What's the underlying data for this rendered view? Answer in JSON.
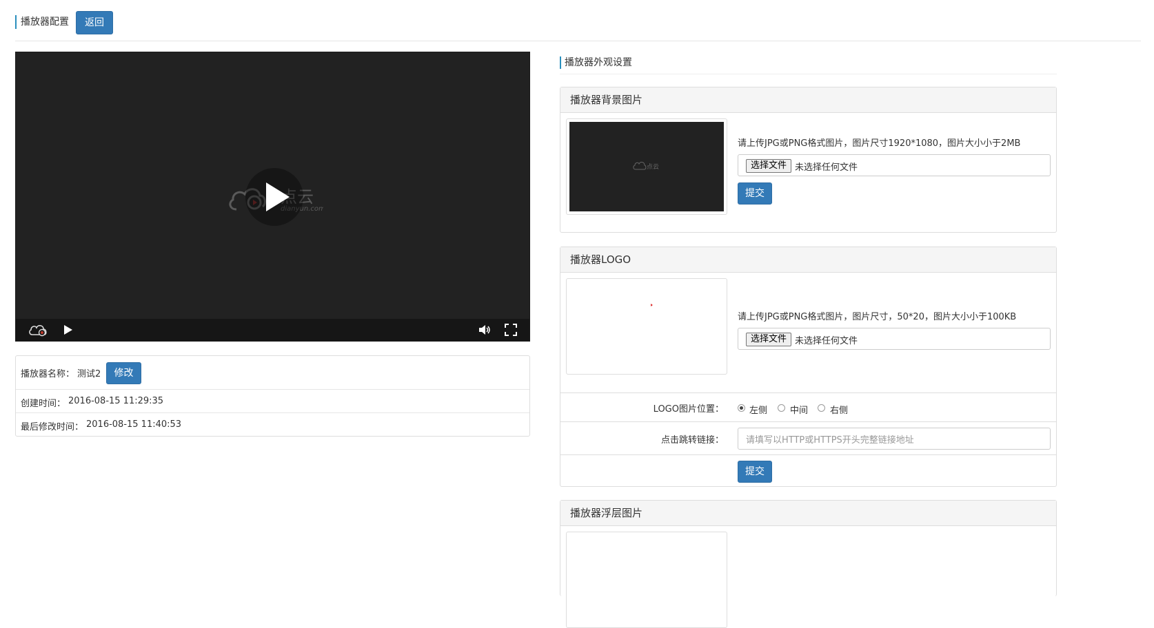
{
  "header": {
    "title": "播放器配置",
    "back_label": "返回"
  },
  "player": {
    "logo_text": "点云",
    "logo_domain": "dianyun.com",
    "controls": [
      "cloud-logo-icon",
      "play-icon",
      "volume-icon",
      "fullscreen-icon"
    ]
  },
  "info": {
    "name_label": "播放器名称：",
    "name_value": "测试2",
    "modify_label": "修改",
    "created_label": "创建时间：",
    "created_value": "2016-08-15 11:29:35",
    "modified_label": "最后修改时间：",
    "modified_value": "2016-08-15 11:40:53"
  },
  "appearance": {
    "section_title": "播放器外观设置",
    "background": {
      "heading": "播放器背景图片",
      "thumb_text": "点云",
      "hint": "请上传JPG或PNG格式图片，图片尺寸1920*1080，图片大小小于2MB",
      "file_button": "选择文件",
      "file_status": "未选择任何文件",
      "submit_label": "提交"
    },
    "logo": {
      "heading": "播放器LOGO",
      "hint": "请上传JPG或PNG格式图片，图片尺寸，50*20，图片大小小于100KB",
      "file_button": "选择文件",
      "file_status": "未选择任何文件",
      "position_label": "LOGO图片位置：",
      "position_options": [
        "左侧",
        "中间",
        "右侧"
      ],
      "position_selected": "左侧",
      "link_label": "点击跳转链接：",
      "link_placeholder": "请填写以HTTP或HTTPS开头完整链接地址",
      "submit_label": "提交"
    },
    "overlay": {
      "heading": "播放器浮层图片"
    }
  },
  "colors": {
    "primary": "#337ab7",
    "accent": "#2a8fbd",
    "player_bg": "#222222"
  }
}
